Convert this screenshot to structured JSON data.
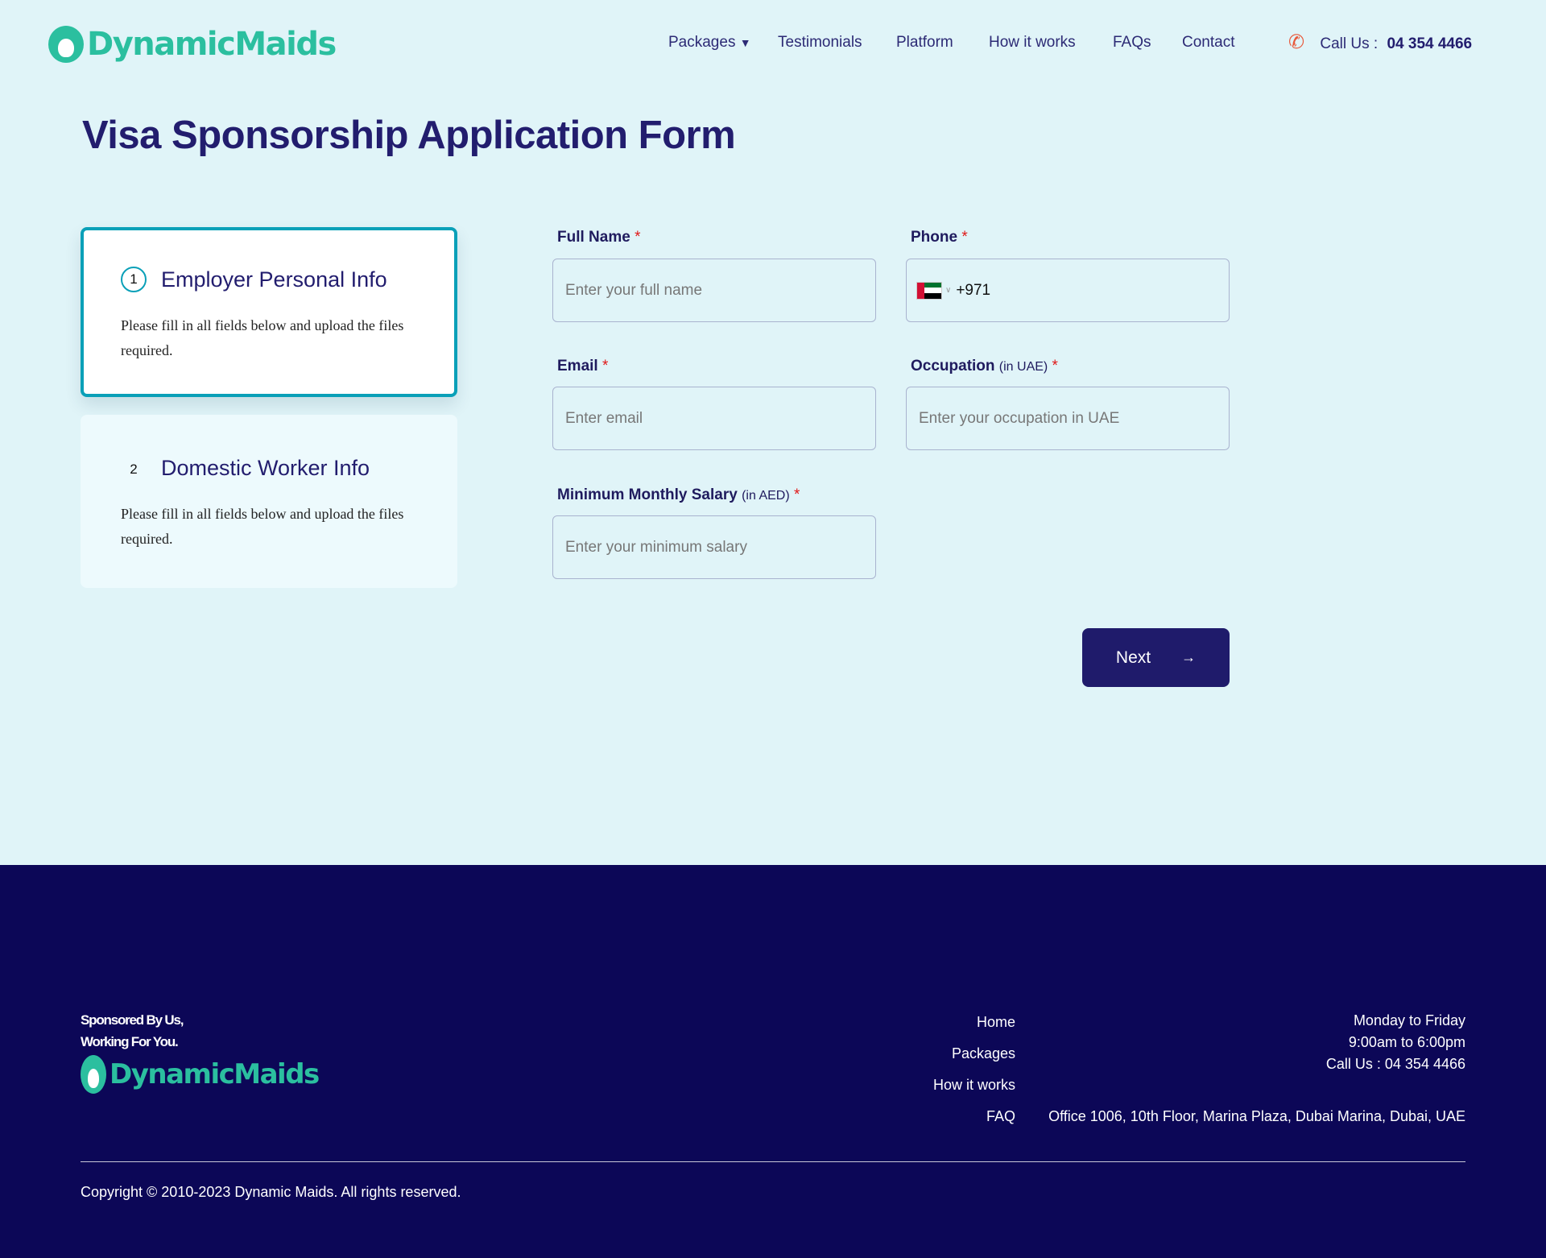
{
  "header": {
    "logo": "DynamicMaids",
    "nav": [
      {
        "label": "Packages",
        "has_dropdown": true
      },
      {
        "label": "Testimonials"
      },
      {
        "label": "Platform"
      },
      {
        "label": "How it works"
      },
      {
        "label": "FAQs"
      },
      {
        "label": "Contact"
      }
    ],
    "call_label": "Call Us :",
    "call_number": "04 354 4466"
  },
  "page_title": "Visa Sponsorship Application Form",
  "steps": [
    {
      "number": "1",
      "title": "Employer Personal Info",
      "description": "Please fill in all fields below and upload the files required.",
      "active": true
    },
    {
      "number": "2",
      "title": "Domestic Worker Info",
      "description": "Please fill in all fields below and upload the files required.",
      "active": false
    }
  ],
  "form": {
    "full_name": {
      "label": "Full Name",
      "required": "*",
      "placeholder": "Enter your full name"
    },
    "phone": {
      "label": "Phone",
      "required": "*",
      "country": "UAE",
      "code": "+971"
    },
    "email": {
      "label": "Email",
      "required": "*",
      "placeholder": "Enter email"
    },
    "occupation": {
      "label": "Occupation",
      "sub": "(in UAE)",
      "required": "*",
      "placeholder": "Enter your occupation in UAE"
    },
    "salary": {
      "label": "Minimum Monthly Salary",
      "sub": "(in AED)",
      "required": "*",
      "placeholder": "Enter your minimum salary"
    },
    "next_label": "Next"
  },
  "footer": {
    "tagline_1": "Sponsored By Us,",
    "tagline_2": "Working For You.",
    "logo": "DynamicMaids",
    "links": [
      "Home",
      "Packages",
      "How it works",
      "FAQ"
    ],
    "hours_days": "Monday to Friday",
    "hours_time": "9:00am to 6:00pm",
    "call": "Call Us : 04 354 4466",
    "address": "Office 1006, 10th Floor, Marina Plaza, Dubai Marina, Dubai, UAE",
    "copyright": "Copyright © 2010-2023 Dynamic Maids. All rights reserved."
  },
  "colors": {
    "brand_teal": "#2bbf9f",
    "navy": "#1f1b6b",
    "footer_bg": "#0c0757",
    "accent_border": "#0aa0b8"
  }
}
